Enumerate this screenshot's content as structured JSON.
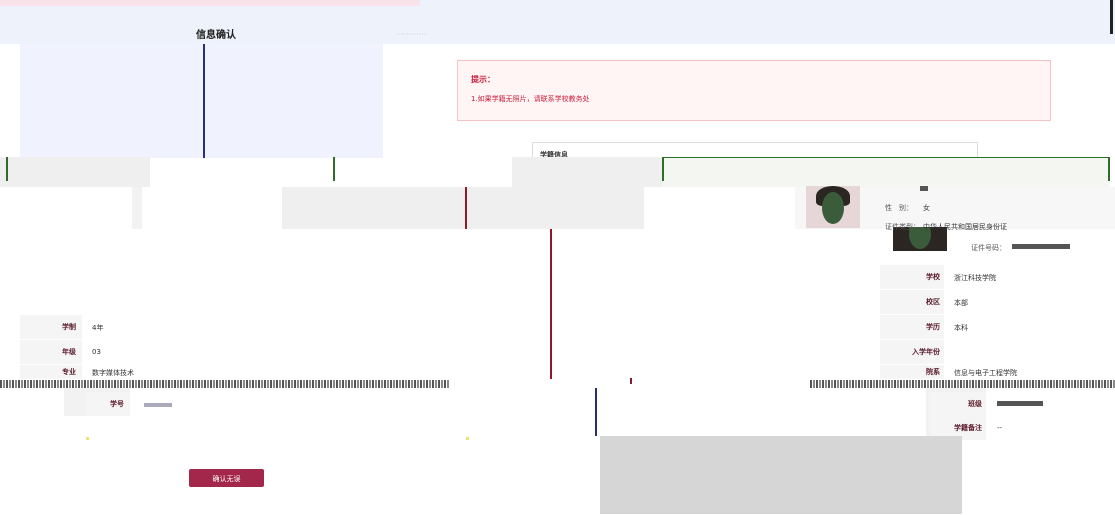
{
  "header": {
    "title": "信息确认"
  },
  "hint": {
    "title": "提示：",
    "message": "1.如果学籍无照片，请联系学校教务处"
  },
  "section": {
    "title": "学籍信息"
  },
  "personal": {
    "gender_label": "性　别：",
    "gender_value": "女",
    "id_type_label": "证件类型：",
    "id_type_value": "中华人民共和国居民身份证",
    "id_number_label": "证件号码："
  },
  "right_table": [
    {
      "label": "学校",
      "value": "浙江科技学院"
    },
    {
      "label": "校区",
      "value": "本部"
    },
    {
      "label": "学历",
      "value": "本科"
    },
    {
      "label": "入学年份",
      "value": ""
    },
    {
      "label": "院系",
      "value": "信息与电子工程学院"
    }
  ],
  "right_bottom": [
    {
      "label": "班级",
      "value": ""
    },
    {
      "label": "学籍备注",
      "value": "--"
    }
  ],
  "left_table": [
    {
      "label": "学制",
      "value": "4年"
    },
    {
      "label": "年级",
      "value": "03"
    },
    {
      "label": "专业",
      "value": "数字媒体技术"
    }
  ],
  "left_bottom": {
    "label": "学号"
  },
  "actions": {
    "confirm": "确认无误"
  },
  "colors": {
    "accent": "#a3274a",
    "hint_text": "#c81d3a",
    "header_bg": "#eef2fb"
  }
}
